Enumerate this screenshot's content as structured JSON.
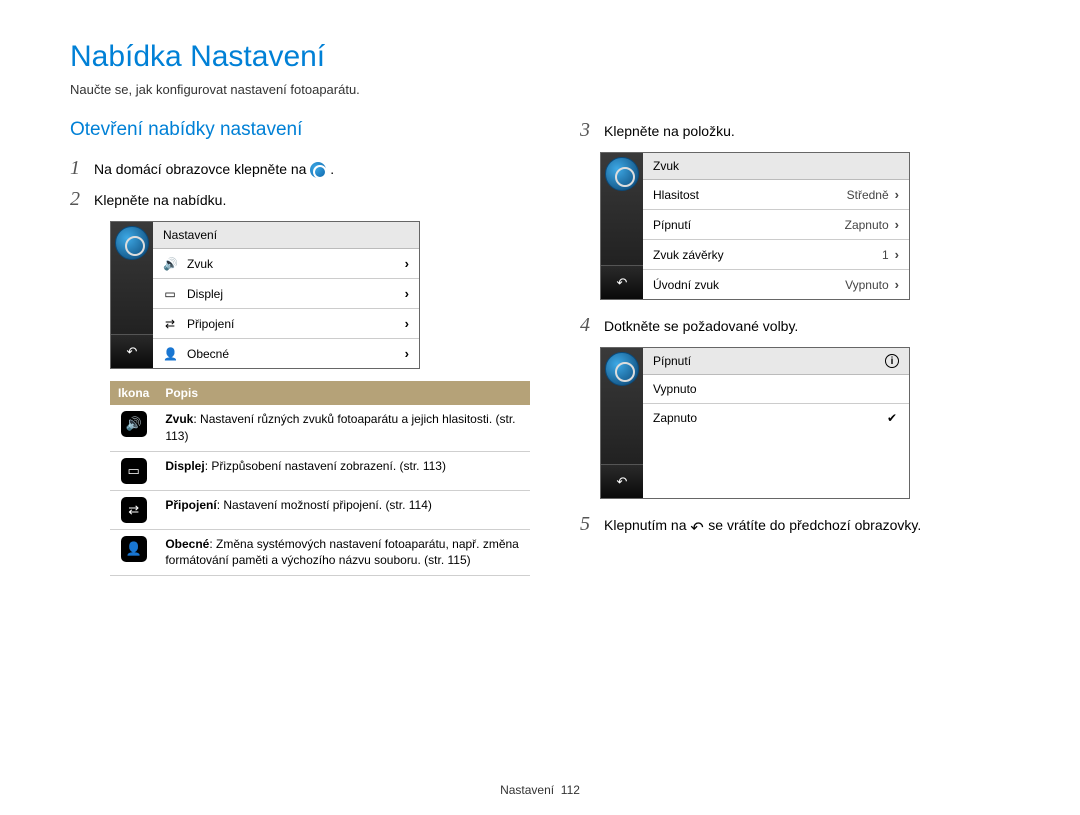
{
  "title": "Nabídka Nastavení",
  "subtitle": "Naučte se, jak konfigurovat nastavení fotoaparátu.",
  "left": {
    "heading": "Otevření nabídky nastavení",
    "steps": {
      "n1": "1",
      "t1a": "Na domácí obrazovce klepněte na ",
      "t1b": ".",
      "n2": "2",
      "t2": "Klepněte na nabídku."
    },
    "screen": {
      "header": "Nastavení",
      "items": [
        {
          "icon": "sound",
          "label": "Zvuk"
        },
        {
          "icon": "display",
          "label": "Displej"
        },
        {
          "icon": "connect",
          "label": "Připojení"
        },
        {
          "icon": "general",
          "label": "Obecné"
        }
      ]
    },
    "table": {
      "h1": "Ikona",
      "h2": "Popis",
      "rows": [
        {
          "icon": "sound",
          "bold": "Zvuk",
          "text": ": Nastavení různých zvuků fotoaparátu a jejich hlasitosti. (str. 113)"
        },
        {
          "icon": "display",
          "bold": "Displej",
          "text": ": Přizpůsobení nastavení zobrazení. (str. 113)"
        },
        {
          "icon": "connect",
          "bold": "Připojení",
          "text": ": Nastavení možností připojení. (str. 114)"
        },
        {
          "icon": "general",
          "bold": "Obecné",
          "text": ": Změna systémových nastavení fotoaparátu, např. změna formátování paměti a výchozího názvu souboru. (str. 115)"
        }
      ]
    }
  },
  "right": {
    "step3": {
      "n": "3",
      "t": "Klepněte na položku."
    },
    "screen1": {
      "header": "Zvuk",
      "items": [
        {
          "label": "Hlasitost",
          "value": "Středně"
        },
        {
          "label": "Pípnutí",
          "value": "Zapnuto"
        },
        {
          "label": "Zvuk závěrky",
          "value": "1"
        },
        {
          "label": "Úvodní zvuk",
          "value": "Vypnuto"
        }
      ]
    },
    "step4": {
      "n": "4",
      "t": "Dotkněte se požadované volby."
    },
    "screen2": {
      "header": "Pípnutí",
      "items": [
        {
          "label": "Vypnuto",
          "checked": false
        },
        {
          "label": "Zapnuto",
          "checked": true
        }
      ]
    },
    "step5": {
      "n": "5",
      "ta": "Klepnutím na ",
      "tb": " se vrátíte do předchozí obrazovky."
    }
  },
  "footer": {
    "label": "Nastavení",
    "page": "112"
  }
}
